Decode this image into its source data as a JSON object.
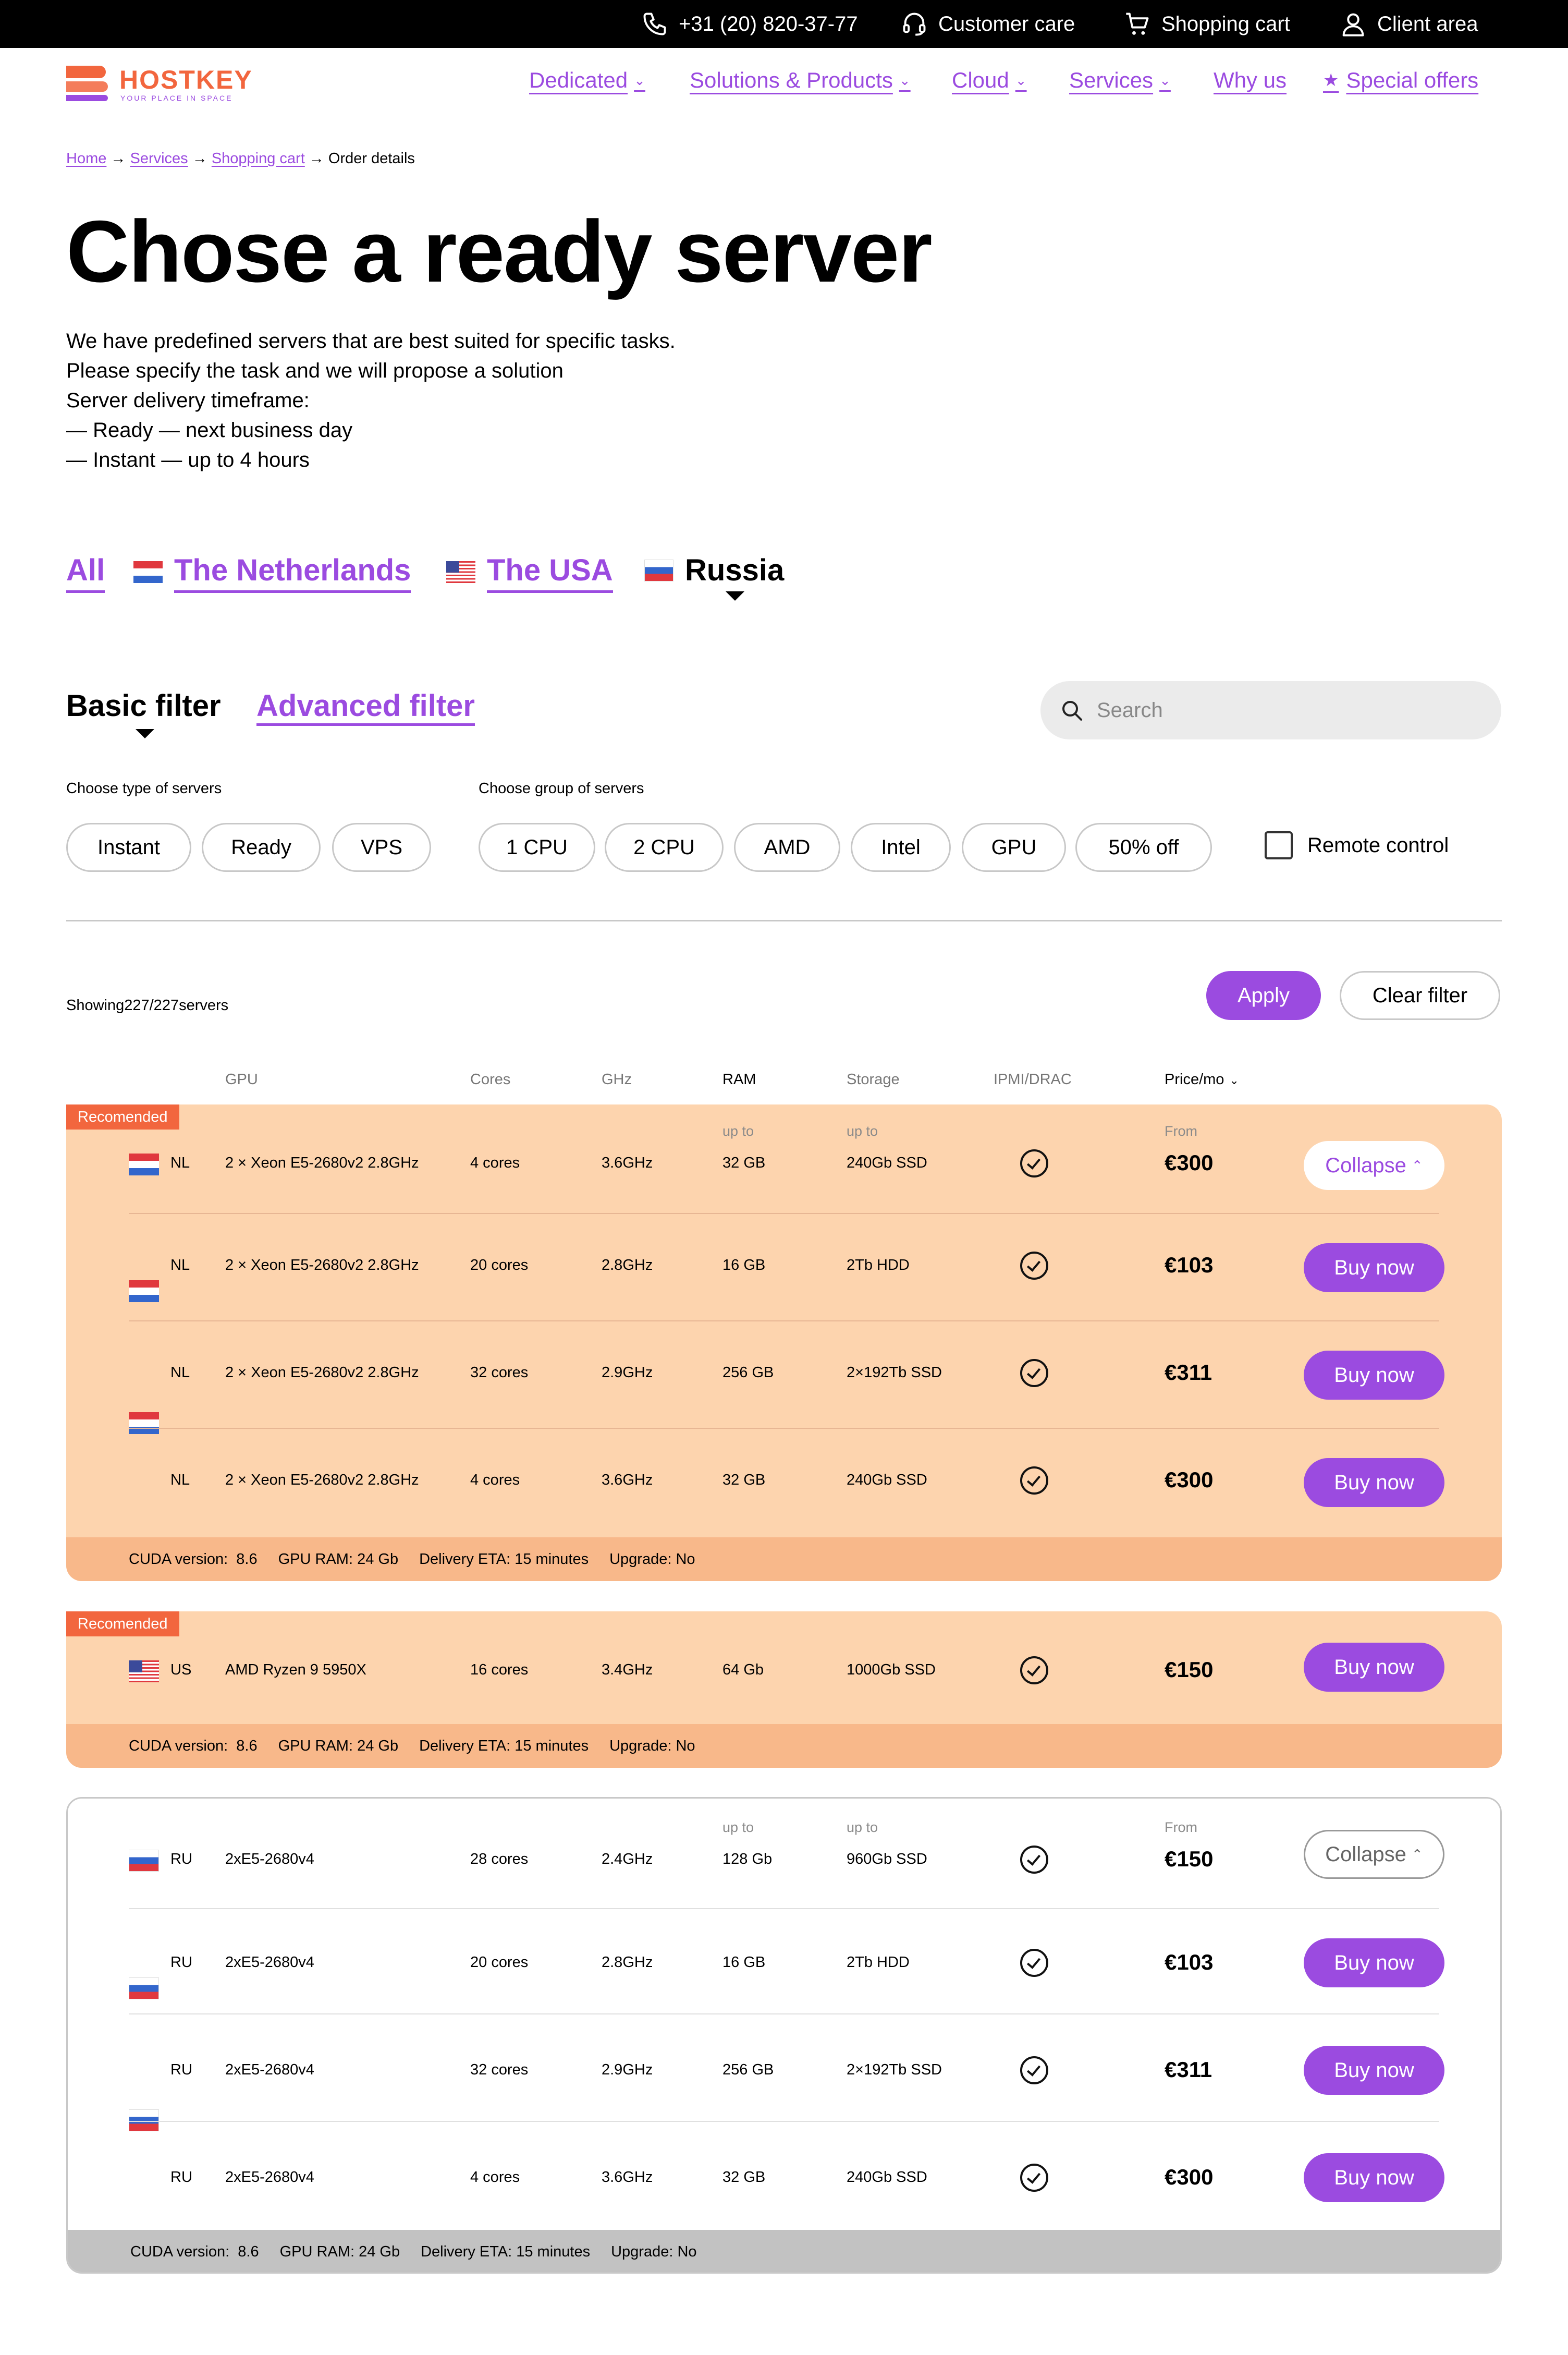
{
  "topbar": {
    "phone": "+31 (20) 820-37-77",
    "customer_care": "Customer care",
    "shopping_cart": "Shopping cart",
    "client_area": "Client area"
  },
  "logo": {
    "name": "HOSTKEY",
    "tagline": "YOUR PLACE IN SPACE"
  },
  "nav": {
    "dedicated": "Dedicated",
    "solutions": "Solutions & Products",
    "cloud": "Cloud",
    "services": "Services",
    "why_us": "Why us",
    "special_offers": "Special offers"
  },
  "breadcrumb": {
    "home": "Home",
    "services": "Services",
    "cart": "Shopping cart",
    "current": "Order details",
    "separator": "→"
  },
  "page_title": "Chose a ready server",
  "intro": [
    "We have predefined servers that are best suited for specific tasks.",
    "Please specify the task and we will propose a solution",
    "Server delivery timeframe:",
    "— Ready — next business day",
    "— Instant — up to 4 hours"
  ],
  "country_tabs": {
    "all": "All",
    "nl": "The Netherlands",
    "usa": "The USA",
    "russia": "Russia",
    "active": "russia"
  },
  "filter_tabs": {
    "basic": "Basic filter",
    "advanced": "Advanced filter",
    "active": "basic"
  },
  "search": {
    "placeholder": "Search"
  },
  "filters": {
    "type_label": "Choose type of servers",
    "types": [
      "Instant",
      "Ready",
      "VPS"
    ],
    "group_label": "Choose group of servers",
    "groups": [
      "1 CPU",
      "2 CPU",
      "AMD",
      "Intel",
      "GPU",
      "50% off"
    ],
    "remote_control": "Remote control"
  },
  "showing": "Showing227/227servers",
  "buttons": {
    "apply": "Apply",
    "clear": "Clear filter",
    "buy": "Buy now",
    "collapse": "Collapse"
  },
  "columns": {
    "gpu": "GPU",
    "cores": "Cores",
    "ghz": "GHz",
    "ram": "RAM",
    "storage": "Storage",
    "ipmi": "IPMI/DRAC",
    "price": "Price/mo"
  },
  "labels": {
    "up_to": "up to",
    "from": "From",
    "recommended": "Recomended"
  },
  "groups": [
    {
      "recommended": true,
      "rows": [
        {
          "country": "NL",
          "gpu": "2 × Xeon E5-2680v2 2.8GHz",
          "cores": "4 cores",
          "ghz": "3.6GHz",
          "ram": "32 GB",
          "storage": "240Gb SSD",
          "price": "€300",
          "action": "collapse"
        },
        {
          "country": "NL",
          "gpu": "2 × Xeon E5-2680v2 2.8GHz",
          "cores": "20 cores",
          "ghz": "2.8GHz",
          "ram": "16 GB",
          "storage": "2Tb HDD",
          "price": "€103",
          "action": "buy"
        },
        {
          "country": "NL",
          "gpu": "2 × Xeon E5-2680v2 2.8GHz",
          "cores": "32 cores",
          "ghz": "2.9GHz",
          "ram": "256 GB",
          "storage": "2×192Tb SSD",
          "price": "€311",
          "action": "buy"
        },
        {
          "country": "NL",
          "gpu": "2 × Xeon E5-2680v2 2.8GHz",
          "cores": "4 cores",
          "ghz": "3.6GHz",
          "ram": "32 GB",
          "storage": "240Gb SSD",
          "price": "€300",
          "action": "buy"
        }
      ],
      "footer": {
        "cuda": "CUDA version:  8.6",
        "gpu_ram": "GPU RAM: 24 Gb",
        "eta": "Delivery ETA: 15 minutes",
        "upgrade": "Upgrade: No"
      }
    },
    {
      "recommended": true,
      "rows": [
        {
          "country": "US",
          "gpu": "AMD Ryzen 9 5950X",
          "cores": "16 cores",
          "ghz": "3.4GHz",
          "ram": "64 Gb",
          "storage": "1000Gb SSD",
          "price": "€150",
          "action": "buy"
        }
      ],
      "footer": {
        "cuda": "CUDA version:  8.6",
        "gpu_ram": "GPU RAM: 24 Gb",
        "eta": "Delivery ETA: 15 minutes",
        "upgrade": "Upgrade: No"
      }
    },
    {
      "recommended": false,
      "rows": [
        {
          "country": "RU",
          "gpu": "2xE5-2680v4",
          "cores": "28 cores",
          "ghz": "2.4GHz",
          "ram": "128 Gb",
          "storage": "960Gb SSD",
          "price": "€150",
          "action": "collapse"
        },
        {
          "country": "RU",
          "gpu": "2xE5-2680v4",
          "cores": "20 cores",
          "ghz": "2.8GHz",
          "ram": "16 GB",
          "storage": "2Tb HDD",
          "price": "€103",
          "action": "buy"
        },
        {
          "country": "RU",
          "gpu": "2xE5-2680v4",
          "cores": "32 cores",
          "ghz": "2.9GHz",
          "ram": "256 GB",
          "storage": "2×192Tb SSD",
          "price": "€311",
          "action": "buy"
        },
        {
          "country": "RU",
          "gpu": "2xE5-2680v4",
          "cores": "4 cores",
          "ghz": "3.6GHz",
          "ram": "32 GB",
          "storage": "240Gb SSD",
          "price": "€300",
          "action": "buy"
        }
      ],
      "footer": {
        "cuda": "CUDA version:  8.6",
        "gpu_ram": "GPU RAM: 24 Gb",
        "eta": "Delivery ETA: 15 minutes",
        "upgrade": "Upgrade: No"
      }
    }
  ],
  "colors": {
    "accent": "#9b4be0",
    "recommended_bg": "#fdd4ae",
    "badge": "#f2663e",
    "logo_orange": "#f2663e",
    "logo_purple": "#9b4be0"
  }
}
